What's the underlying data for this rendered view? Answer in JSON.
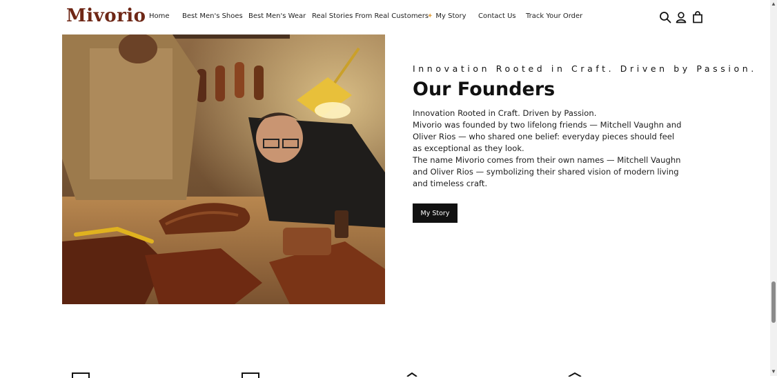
{
  "header": {
    "logo": "Mivorio",
    "nav": [
      {
        "label": "Home"
      },
      {
        "label": "Best Men's Shoes"
      },
      {
        "label": "Best Men's Wear"
      },
      {
        "label": "Real Stories From Real Customers"
      },
      {
        "label": "My Story",
        "icon": "sparkle-icon"
      },
      {
        "label": "Contact Us"
      },
      {
        "label": "Track Your Order"
      }
    ],
    "icons": [
      "search-icon",
      "account-icon",
      "cart-bag-icon"
    ]
  },
  "founders": {
    "kicker": "Innovation Rooted in Craft. Driven by Passion.",
    "title": "Our Founders",
    "paragraphs": [
      "Innovation Rooted in Craft. Driven by Passion.",
      "Mivorio was founded by two lifelong friends — Mitchell Vaughn and Oliver Rios — who shared one belief: everyday pieces should feel as exceptional as they look.",
      "The name Mivorio comes from their own names — Mitchell Vaughn and Oliver Rios — symbolizing their shared vision of modern living and timeless craft."
    ],
    "button": "My Story",
    "image": "two-craftsmen-making-leather-shoes-photo"
  },
  "colors": {
    "brand": "#6e2716",
    "button_bg": "#111111",
    "accent": "#e2a64a"
  }
}
